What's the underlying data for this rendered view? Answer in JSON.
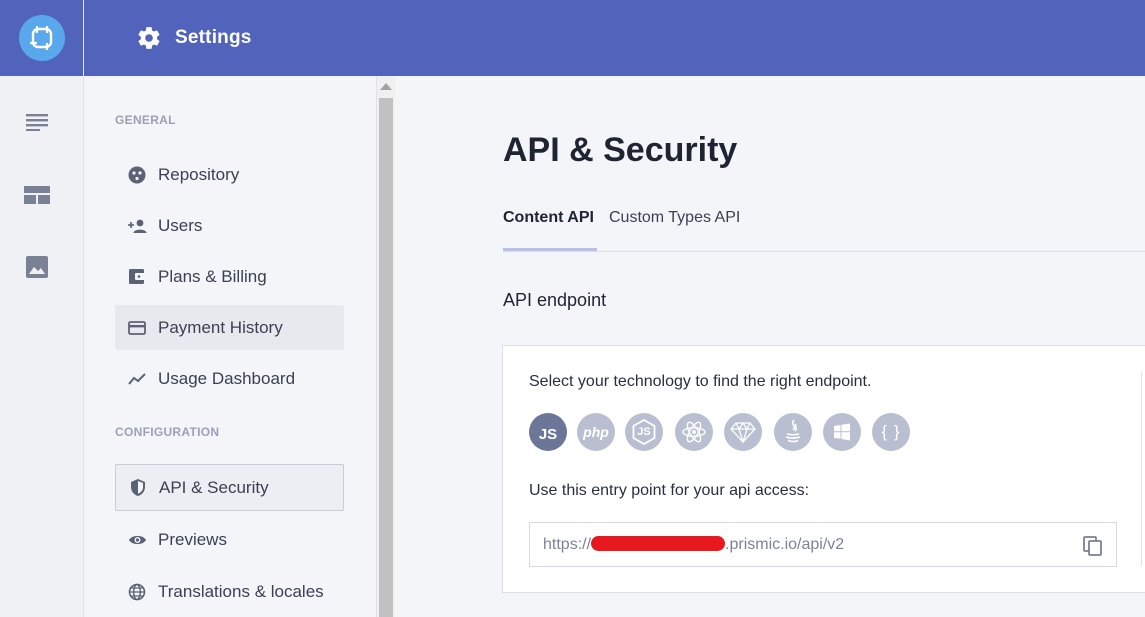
{
  "header": {
    "title": "Settings"
  },
  "rail": {
    "icons": [
      "document-list-icon",
      "layout-icon",
      "image-icon"
    ]
  },
  "sidebar": {
    "sections": [
      {
        "label": "GENERAL"
      },
      {
        "label": "CONFIGURATION"
      }
    ],
    "items": [
      {
        "label": "Repository",
        "icon": "palette-icon"
      },
      {
        "label": "Users",
        "icon": "add-user-icon"
      },
      {
        "label": "Plans & Billing",
        "icon": "wallet-icon"
      },
      {
        "label": "Payment History",
        "icon": "credit-card-icon"
      },
      {
        "label": "Usage Dashboard",
        "icon": "trend-line-icon"
      },
      {
        "label": "API & Security",
        "icon": "shield-icon"
      },
      {
        "label": "Previews",
        "icon": "eye-icon"
      },
      {
        "label": "Translations & locales",
        "icon": "globe-icon"
      }
    ],
    "hovered_item": "Payment History",
    "active_item": "API & Security"
  },
  "main": {
    "title": "API & Security",
    "tabs": [
      {
        "label": "Content API",
        "active": true
      },
      {
        "label": "Custom Types API",
        "active": false
      }
    ],
    "section_title": "API endpoint",
    "card": {
      "technology_prompt": "Select your technology to find the right endpoint.",
      "technologies": [
        {
          "label": "JS",
          "icon": "javascript-icon",
          "selected": true
        },
        {
          "label": "php",
          "icon": "php-icon",
          "selected": false
        },
        {
          "label": "JS",
          "icon": "nodejs-icon",
          "selected": false
        },
        {
          "label": "",
          "icon": "react-icon",
          "selected": false
        },
        {
          "label": "",
          "icon": "ruby-icon",
          "selected": false
        },
        {
          "label": "",
          "icon": "java-icon",
          "selected": false
        },
        {
          "label": "",
          "icon": "windows-icon",
          "selected": false
        },
        {
          "label": "{ }",
          "icon": "json-icon",
          "selected": false
        }
      ],
      "entry_prompt": "Use this entry point for your api access:",
      "endpoint_prefix": "https://",
      "endpoint_suffix": ".prismic.io/api/v2"
    }
  },
  "colors": {
    "header_bg": "#5163ba",
    "logo_bg": "#5aa8ec",
    "tech_selected": "#6b7699",
    "tech_default": "#b9bfd0",
    "tab_underline": "#b6c0ea",
    "redaction": "#e8191e"
  }
}
